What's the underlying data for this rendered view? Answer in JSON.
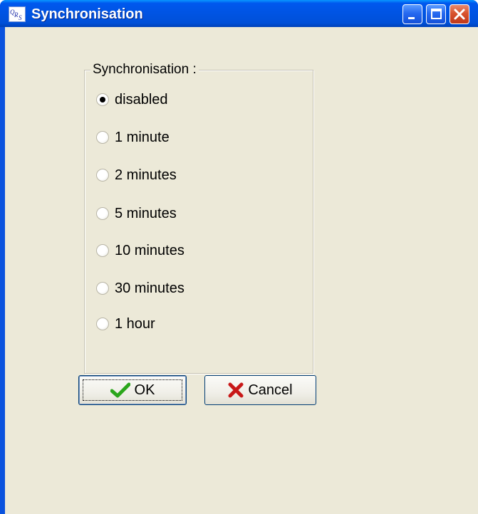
{
  "window": {
    "title": "Synchronisation",
    "icon": "app-qrs-icon",
    "controls": [
      "minimize-icon",
      "maximize-icon",
      "close-icon"
    ]
  },
  "group": {
    "legend": "Synchronisation :",
    "options": [
      {
        "label": "disabled",
        "checked": true
      },
      {
        "label": "1 minute",
        "checked": false
      },
      {
        "label": "2 minutes",
        "checked": false
      },
      {
        "label": "5 minutes",
        "checked": false
      },
      {
        "label": "10 minutes",
        "checked": false
      },
      {
        "label": "30 minutes",
        "checked": false
      },
      {
        "label": "1 hour",
        "checked": false
      }
    ]
  },
  "buttons": {
    "ok_label": "OK",
    "ok_icon": "checkmark-icon",
    "cancel_label": "Cancel",
    "cancel_icon": "x-cross-icon"
  },
  "colors": {
    "titlebar": "#0053e1",
    "client_bg": "#ece9d8",
    "close_button": "#d8532e",
    "ok_check": "#2aa61b",
    "cancel_x": "#c81818"
  }
}
